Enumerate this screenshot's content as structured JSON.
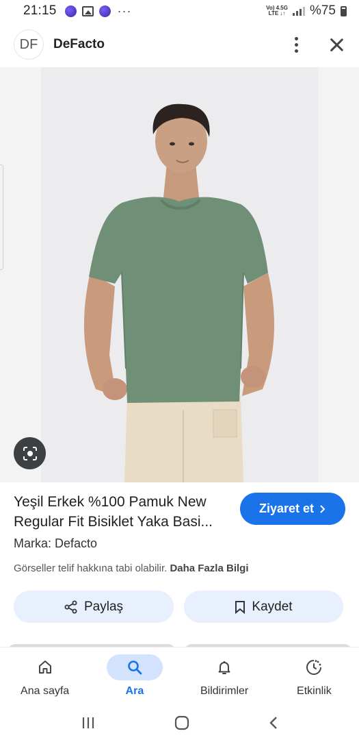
{
  "status_bar": {
    "time": "21:15",
    "more": "···",
    "network_top": "Vo) 4.5G",
    "network_bottom": "LTE ↓↑",
    "battery": "%75"
  },
  "header": {
    "logo_text": "DF",
    "site_name": "DeFacto"
  },
  "product": {
    "title": "Yeşil Erkek %100 Pamuk New Regular Fit Bisiklet Yaka Basi...",
    "visit_label": "Ziyaret et",
    "brand": "Marka: Defacto",
    "copyright_text": "Görseller telif hakkına tabi olabilir.",
    "more_info": "Daha Fazla Bilgi",
    "share_label": "Paylaş",
    "save_label": "Kaydet",
    "shirt_color": "#6f8f77",
    "pants_color": "#e8dcc6"
  },
  "bottom_nav": {
    "items": [
      {
        "label": "Ana sayfa",
        "icon": "home-icon"
      },
      {
        "label": "Ara",
        "icon": "search-icon",
        "active": true
      },
      {
        "label": "Bildirimler",
        "icon": "bell-icon"
      },
      {
        "label": "Etkinlik",
        "icon": "activity-icon"
      }
    ]
  },
  "colors": {
    "accent": "#1a73e8",
    "chip_bg": "#e8f0fe",
    "active_pill": "#d3e3fd"
  }
}
